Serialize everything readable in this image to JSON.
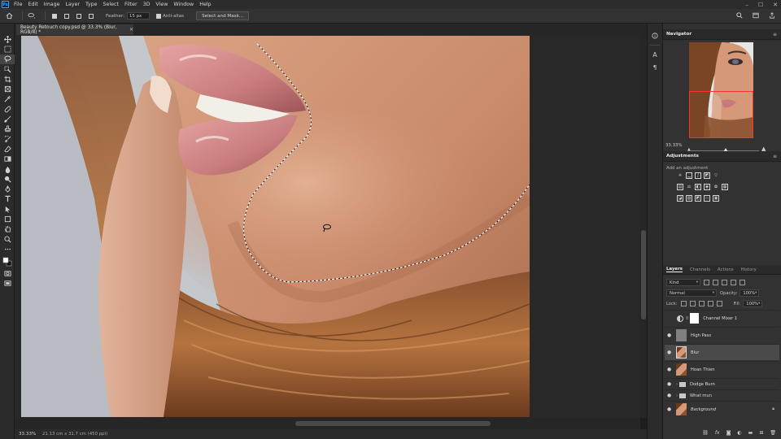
{
  "menu": {
    "logo": "Ps",
    "items": [
      "File",
      "Edit",
      "Image",
      "Layer",
      "Type",
      "Select",
      "Filter",
      "3D",
      "View",
      "Window",
      "Help"
    ]
  },
  "options": {
    "feather_label": "Feather:",
    "feather_value": "15 px",
    "antialias_label": "Anti-alias",
    "select_mask_label": "Select and Mask..."
  },
  "document": {
    "tab_title": "Beauty Retouch copy.psd @ 33.3% (Blur, RGB/8) *",
    "zoom": "33.33%",
    "info": "21.13 cm x 31.7 cm (450 ppi)"
  },
  "navigator": {
    "title": "Navigator",
    "zoom": "33.33%"
  },
  "adjustments": {
    "title": "Adjustments",
    "subtitle": "Add an adjustment"
  },
  "layers_panel": {
    "tabs": [
      "Layers",
      "Channels",
      "Actions",
      "History"
    ],
    "kind_label": "Kind",
    "blend_mode": "Normal",
    "opacity_label": "Opacity:",
    "opacity_value": "100%",
    "lock_label": "Lock:",
    "fill_label": "Fill:",
    "fill_value": "100%",
    "layers": [
      {
        "name": "Channel Mixer 1"
      },
      {
        "name": "High Pass"
      },
      {
        "name": "Blur"
      },
      {
        "name": "Hoan Thien"
      },
      {
        "name": "Dodge Burn"
      },
      {
        "name": "What mun"
      },
      {
        "name": "Background"
      }
    ]
  },
  "colors": {
    "accent": "#31a8ff",
    "nav_box": "#ff3030",
    "selection_layer": "#4a4a4a"
  }
}
